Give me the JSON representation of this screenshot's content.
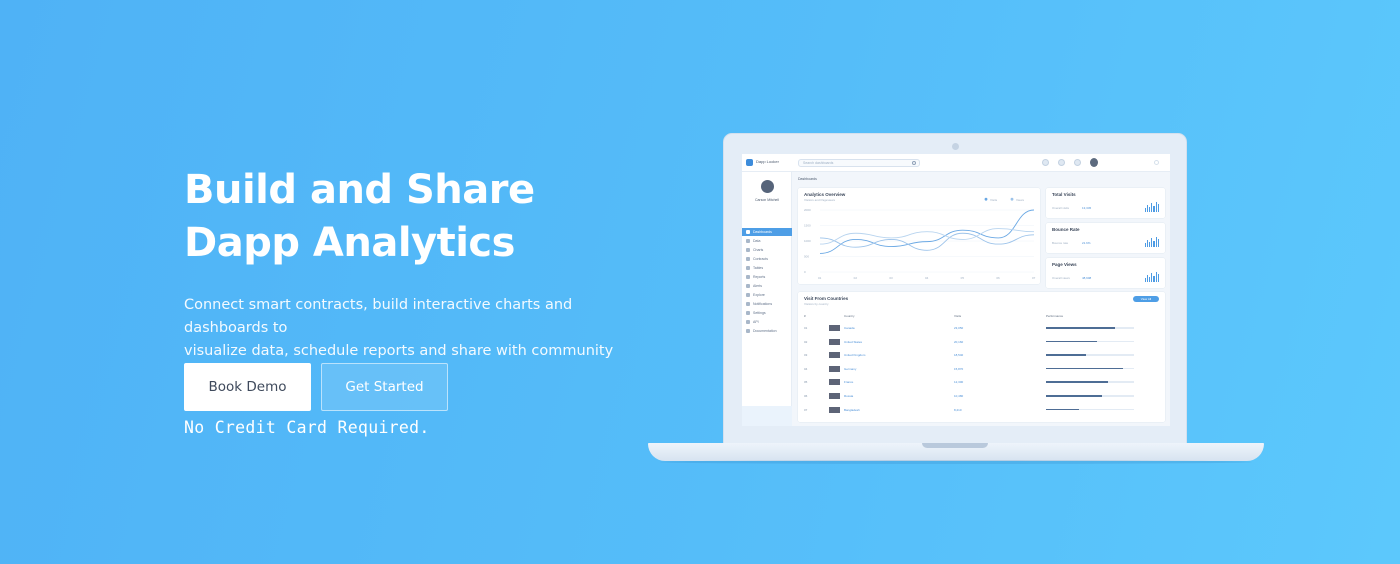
{
  "hero": {
    "title_line1": "Build and Share",
    "title_line2": "Dapp Analytics",
    "subtitle_line1": "Connect smart contracts, build interactive charts and dashboards to",
    "subtitle_line2": "visualize data, schedule reports and share with community",
    "book_demo_label": "Book Demo",
    "get_started_label": "Get Started",
    "note": "No Credit Card Required."
  },
  "colors": {
    "background": "#55bdf9",
    "accent": "#4e9ee6",
    "text_on_bg": "#ffffff"
  },
  "dashboard": {
    "brand": "Dapp Looker",
    "search_placeholder": "Search dashboards",
    "user_name": "Carson Mitchell",
    "sidebar_items": [
      "Dashboards",
      "Data",
      "Charts",
      "Contracts",
      "Tables",
      "Reports",
      "Alerts",
      "Explore",
      "Notifications",
      "Settings",
      "API",
      "Documentation"
    ],
    "active_item_index": 0,
    "breadcrumb": "Dashboards",
    "overview": {
      "title": "Analytics Overview",
      "subtitle": "Visitors and Pageviews",
      "legend": [
        "Visits",
        "Views"
      ],
      "y_ticks": [
        "2000",
        "1500",
        "1000",
        "500",
        "0"
      ],
      "x_ticks": [
        "01",
        "02",
        "03",
        "04",
        "05",
        "06",
        "07"
      ],
      "series": [
        {
          "values": [
            600,
            1050,
            820,
            980,
            1350,
            1100,
            2000
          ]
        },
        {
          "values": [
            1100,
            800,
            1050,
            700,
            1250,
            900,
            1200
          ]
        },
        {
          "values": [
            900,
            1250,
            1100,
            1300,
            1050,
            1400,
            1300
          ]
        }
      ],
      "ylim": [
        0,
        2000
      ]
    },
    "stats": [
      {
        "title": "Total Visits",
        "left": "Overall visits",
        "right": "13,345"
      },
      {
        "title": "Bounce Rate",
        "left": "Bounce rate",
        "right": "21.6%"
      },
      {
        "title": "Page Views",
        "left": "Overall views",
        "right": "48,908"
      }
    ],
    "table": {
      "title": "Visit From Countries",
      "subtitle": "Visitors by country",
      "button": "View All",
      "headers": [
        "#",
        "Country",
        "Visits",
        "Performance"
      ],
      "rows": [
        {
          "n": "01",
          "country": "Canada",
          "visits": "23,050",
          "pct": 0.78
        },
        {
          "n": "02",
          "country": "United States",
          "visits": "20,160",
          "pct": 0.58
        },
        {
          "n": "03",
          "country": "United Kingdom",
          "visits": "18,540",
          "pct": 0.46
        },
        {
          "n": "04",
          "country": "Germany",
          "visits": "15,870",
          "pct": 0.88
        },
        {
          "n": "05",
          "country": "France",
          "visits": "12,300",
          "pct": 0.7
        },
        {
          "n": "06",
          "country": "Russia",
          "visits": "10,480",
          "pct": 0.64
        },
        {
          "n": "07",
          "country": "Bangladesh",
          "visits": "8,210",
          "pct": 0.38
        }
      ]
    }
  }
}
